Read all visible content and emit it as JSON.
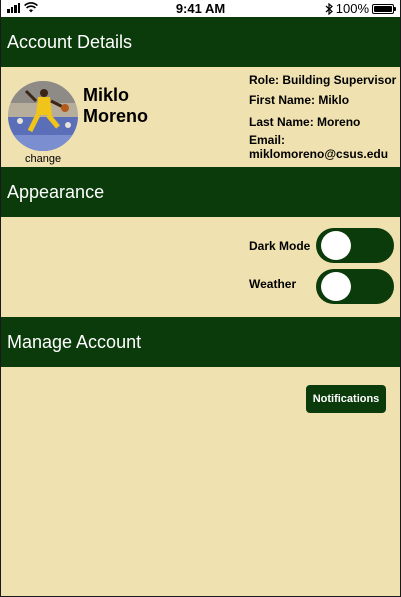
{
  "status_bar": {
    "time": "9:41 AM",
    "battery": "100%",
    "battery_level": 1.0
  },
  "account_details": {
    "header": "Account Details",
    "name_first_line": "Miklo",
    "name_second_line": "Moreno",
    "change_label": "change",
    "role": "Role: Building Supervisor",
    "first_name": "First Name: Miklo",
    "last_name": "Last Name: Moreno",
    "email_label": "Email:",
    "email": "miklomoreno@csus.edu"
  },
  "appearance": {
    "header": "Appearance",
    "dark_mode_label": "Dark Mode",
    "weather_label": "Weather"
  },
  "manage_account": {
    "header": "Manage Account",
    "notifications_button": "Notifications"
  },
  "colors": {
    "header_green": "#0b3b0b",
    "panel_tan": "#efe1b0"
  }
}
